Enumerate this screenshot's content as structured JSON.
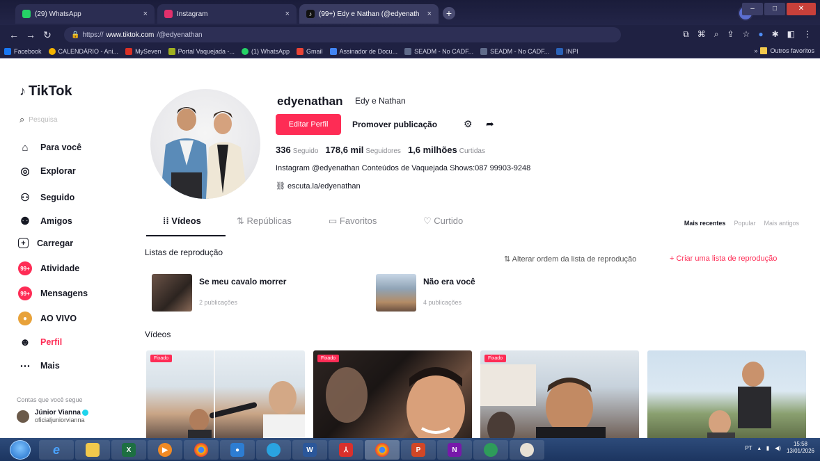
{
  "browser": {
    "tabs": [
      {
        "title": "(29) WhatsApp",
        "color": "#25d366",
        "close": "×"
      },
      {
        "title": "Instagram",
        "color": "#e1306c",
        "close": "×"
      },
      {
        "title": "(99+) Edy e Nathan (@edyenath",
        "color": "#000000",
        "close": "×"
      }
    ],
    "new_tab": "+",
    "url_host": "www.tiktok.com",
    "url_path": "/@edyenathan",
    "url_prefix": "https://",
    "bookmarks": [
      {
        "label": "Facebook",
        "color": "#1877f2"
      },
      {
        "label": "CALENDÁRIO - Ani...",
        "color": "#f4b400"
      },
      {
        "label": "MySeven",
        "color": "#d93025"
      },
      {
        "label": "Portal Vaquejada -...",
        "color": "#a0b020"
      },
      {
        "label": "(1) WhatsApp",
        "color": "#25d366"
      },
      {
        "label": "Gmail",
        "color": "#ea4335"
      },
      {
        "label": "Assinador de Docu...",
        "color": "#4285f4"
      },
      {
        "label": "SEADM - No CADF...",
        "color": "#5f6b8a"
      },
      {
        "label": "SEADM - No CADF...",
        "color": "#5f6b8a"
      },
      {
        "label": "INPI",
        "color": "#2a62b8"
      }
    ],
    "bookmarks_more": "»",
    "bookmarks_other": "Outros favoritos"
  },
  "sidebar": {
    "logo": "TikTok",
    "search_placeholder": "Pesquisa",
    "items": [
      {
        "label": "Para você",
        "icon": "home-icon"
      },
      {
        "label": "Explorar",
        "icon": "compass-icon"
      },
      {
        "label": "Seguido",
        "icon": "following-icon"
      },
      {
        "label": "Amigos",
        "icon": "friends-icon"
      },
      {
        "label": "Carregar",
        "icon": "upload-icon"
      },
      {
        "label": "Atividade",
        "icon": "activity-icon",
        "badge": "99+"
      },
      {
        "label": "Mensagens",
        "icon": "messages-icon",
        "badge": "99+"
      },
      {
        "label": "AO VIVO",
        "icon": "live-icon"
      },
      {
        "label": "Perfil",
        "icon": "profile-icon"
      },
      {
        "label": "Mais",
        "icon": "more-icon"
      }
    ],
    "follows_title": "Contas que você segue",
    "follow": {
      "name": "Júnior Vianna",
      "handle": "oficialjuniorvianna"
    }
  },
  "profile": {
    "username": "edyenathan",
    "nickname": "Edy e Nathan",
    "edit_label": "Editar Perfil",
    "promote_label": "Promover publicação",
    "following_count": "336",
    "following_label": "Seguido",
    "followers_count": "178,6 mil",
    "followers_label": "Seguidores",
    "likes_count": "1,6 milhões",
    "likes_label": "Curtidas",
    "bio": "Instagram @edyenathan Conteúdos de Vaquejada Shows:087 99903-9248",
    "link": "escuta.la/edyenathan"
  },
  "content_tabs": [
    "Vídeos",
    "Repúblicas",
    "Favoritos",
    "Curtido"
  ],
  "sort": [
    "Mais recentes",
    "Popular",
    "Mais antigos"
  ],
  "playlists": {
    "title": "Listas de reprodução",
    "reorder": "Alterar ordem da lista de reprodução",
    "create": "+ Criar uma lista de reprodução",
    "items": [
      {
        "name": "Se meu cavalo morrer",
        "count": "2 publicações"
      },
      {
        "name": "Não era você",
        "count": "4 publicações"
      }
    ]
  },
  "videos": {
    "title": "Vídeos",
    "pinned_label": "Fixado"
  },
  "taskbar": {
    "lang": "PT",
    "time": "15:58",
    "date": "13/01/2026"
  }
}
